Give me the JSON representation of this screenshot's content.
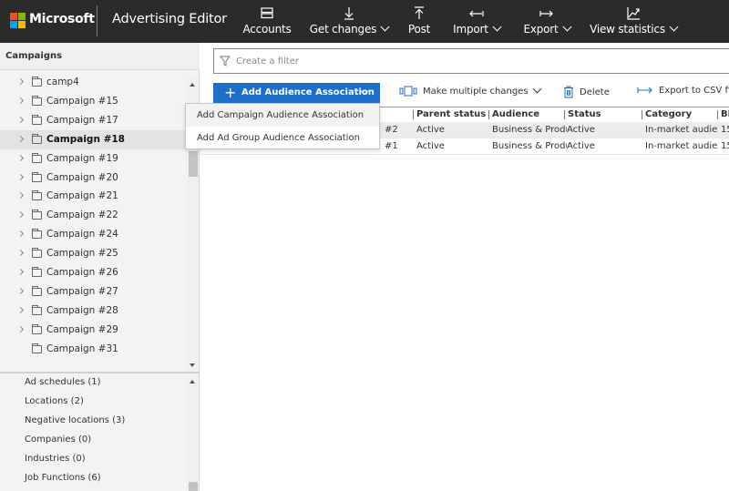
{
  "topbar": {
    "brand": "Microsoft",
    "app_title": "Advertising Editor",
    "logo_colors": [
      "#f25022",
      "#7fba00",
      "#00a4ef",
      "#ffb900"
    ],
    "nav": [
      {
        "label": "Accounts",
        "icon": "accounts-icon",
        "dropdown": false
      },
      {
        "label": "Get changes",
        "icon": "download-icon",
        "dropdown": true
      },
      {
        "label": "Post",
        "icon": "upload-icon",
        "dropdown": false
      },
      {
        "label": "Import",
        "icon": "import-icon",
        "dropdown": true
      },
      {
        "label": "Export",
        "icon": "export-icon",
        "dropdown": true
      },
      {
        "label": "View statistics",
        "icon": "chart-icon",
        "dropdown": true
      }
    ]
  },
  "left_panel": {
    "header": "Campaigns",
    "tree": [
      {
        "label": "camp4",
        "expandable": true,
        "selected": false
      },
      {
        "label": "Campaign #15",
        "expandable": true,
        "selected": false
      },
      {
        "label": "Campaign #17",
        "expandable": true,
        "selected": false
      },
      {
        "label": "Campaign #18",
        "expandable": true,
        "selected": true
      },
      {
        "label": "Campaign #19",
        "expandable": true,
        "selected": false
      },
      {
        "label": "Campaign #20",
        "expandable": true,
        "selected": false
      },
      {
        "label": "Campaign #21",
        "expandable": true,
        "selected": false
      },
      {
        "label": "Campaign #22",
        "expandable": true,
        "selected": false
      },
      {
        "label": "Campaign #24",
        "expandable": true,
        "selected": false
      },
      {
        "label": "Campaign #25",
        "expandable": true,
        "selected": false
      },
      {
        "label": "Campaign #26",
        "expandable": true,
        "selected": false
      },
      {
        "label": "Campaign #27",
        "expandable": true,
        "selected": false
      },
      {
        "label": "Campaign #28",
        "expandable": true,
        "selected": false
      },
      {
        "label": "Campaign #29",
        "expandable": true,
        "selected": false
      },
      {
        "label": "Campaign #31",
        "expandable": false,
        "selected": false
      }
    ],
    "properties": [
      "Ad schedules (1)",
      "Locations (2)",
      "Negative locations (3)",
      "Companies (0)",
      "Industries (0)",
      "Job Functions (6)"
    ]
  },
  "main": {
    "filter_placeholder": "Create a filter",
    "toolbar": {
      "add_label": "Add Audience Association",
      "multi_label": "Make multiple changes",
      "delete_label": "Delete",
      "export_label": "Export to CSV file"
    },
    "dropdown": [
      "Add Campaign Audience Association",
      "Add Ad Group Audience Association"
    ],
    "columns": [
      "",
      "Parent status",
      "Audience",
      "Status",
      "Category",
      "Bid adjustment"
    ],
    "rows": [
      {
        "name": "#2",
        "parent_status": "Active",
        "audience": "Business & Product",
        "status": "Active",
        "category": "In-market audience",
        "bid": "15",
        "selected": true
      },
      {
        "name": "#1",
        "parent_status": "Active",
        "audience": "Business & Product",
        "status": "Active",
        "category": "In-market audience",
        "bid": "15",
        "selected": false
      }
    ],
    "accent_color": "#1e6fc8"
  }
}
